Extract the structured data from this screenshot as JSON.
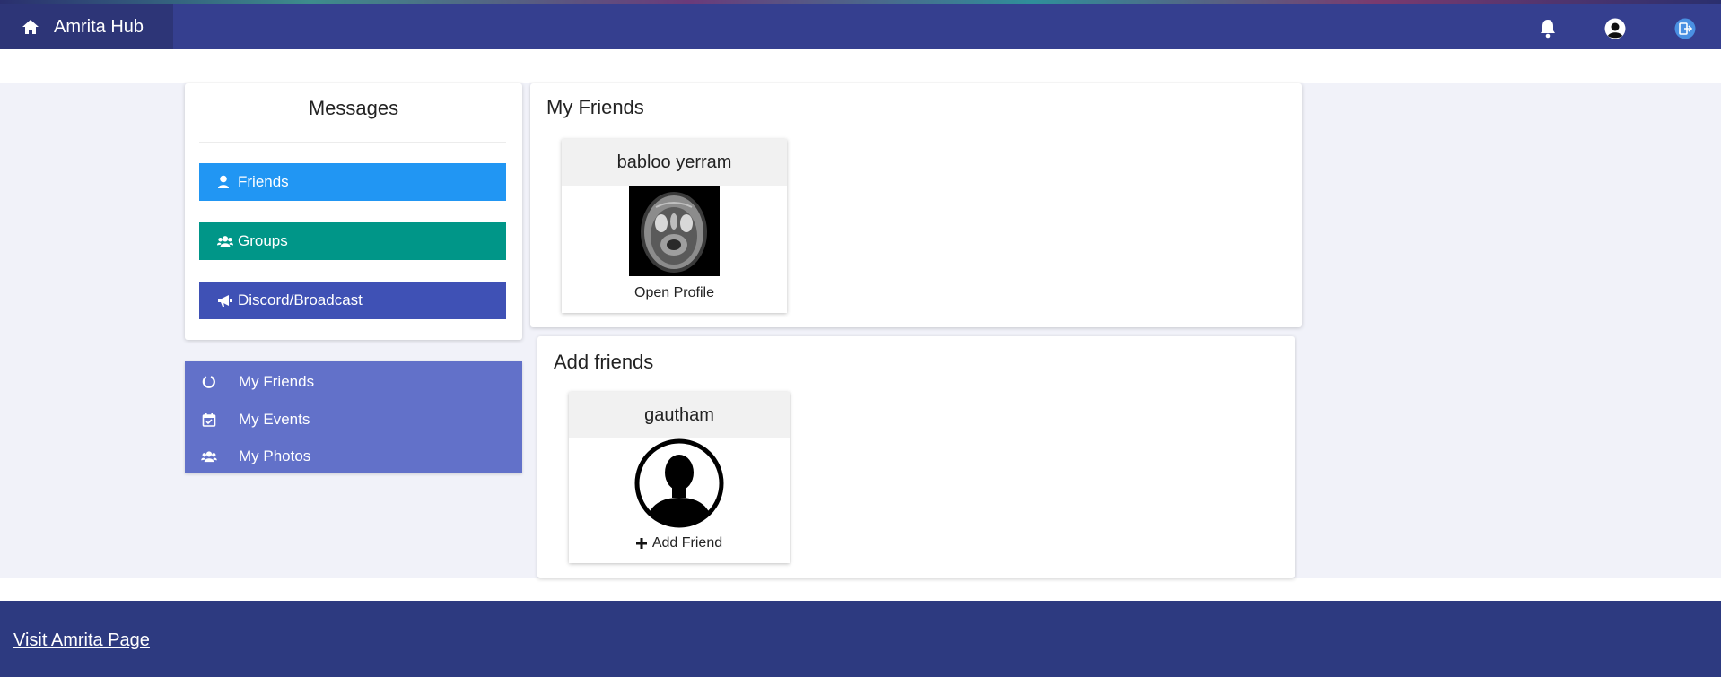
{
  "header": {
    "brand": "Amrita Hub",
    "icons": [
      "home-icon",
      "bell-icon",
      "user-avatar-icon",
      "logout-icon"
    ]
  },
  "messages": {
    "title": "Messages",
    "buttons": [
      {
        "label": "Friends",
        "icon": "user-icon",
        "color": "#2196f3"
      },
      {
        "label": "Groups",
        "icon": "users-icon",
        "color": "#009688"
      },
      {
        "label": "Discord/Broadcast",
        "icon": "megaphone-icon",
        "color": "#3f51b5"
      }
    ]
  },
  "side_menu": {
    "items": [
      {
        "label": "My Friends",
        "icon": "circle-notch-icon"
      },
      {
        "label": "My Events",
        "icon": "calendar-check-icon"
      },
      {
        "label": "My Photos",
        "icon": "users-icon"
      }
    ]
  },
  "my_friends": {
    "title": "My Friends",
    "friends": [
      {
        "name": "babloo yerram",
        "action": "Open Profile"
      }
    ]
  },
  "add_friends": {
    "title": "Add friends",
    "suggestions": [
      {
        "name": "gautham",
        "action": "Add Friend"
      }
    ]
  },
  "footer": {
    "link": "Visit Amrita Page"
  },
  "colors": {
    "topbar": "#353f8f",
    "brand_bg": "#2d3577",
    "content_bg": "#f1f2f9",
    "side_menu": "#6271c9",
    "footer": "#2d3a80"
  }
}
